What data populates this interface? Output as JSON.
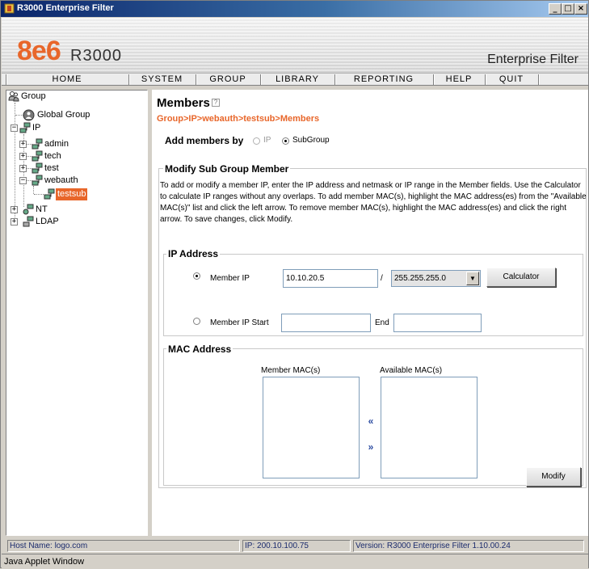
{
  "window": {
    "title": "R3000 Enterprise Filter",
    "controls": {
      "minimize": "_",
      "maximize": "□",
      "close": "×"
    }
  },
  "header": {
    "logo_brand": "8e6",
    "logo_product": "R3000",
    "tagline": "Enterprise Filter"
  },
  "nav": {
    "items": [
      "HOME",
      "SYSTEM",
      "GROUP",
      "LIBRARY",
      "REPORTING",
      "HELP",
      "QUIT"
    ]
  },
  "tree": {
    "root": "Group",
    "global_group": "Global Group",
    "ip": "IP",
    "admin": "admin",
    "tech": "tech",
    "test": "test",
    "webauth": "webauth",
    "testsub": "testsub",
    "nt": "NT",
    "ldap": "LDAP",
    "expand_collapsed": "+",
    "expand_open": "−"
  },
  "main": {
    "title": "Members",
    "help_icon": "?",
    "breadcrumb": "Group>IP>webauth>testsub>Members",
    "add_members_by": {
      "label": "Add members by",
      "options": [
        "IP",
        "SubGroup"
      ],
      "selected": "SubGroup"
    },
    "modify_frame": {
      "title": "Modify Sub Group Member",
      "description": "To add or modify a member IP, enter the IP address and netmask or IP range in the Member fields. Use the Calculator to calculate IP ranges without any overlaps. To add member MAC(s), highlight the MAC address(es) from the \"Available MAC(s)\" list and click the left arrow. To remove member MAC(s), highlight the MAC address(es) and click the right arrow. To save changes, click Modify."
    },
    "ip_address": {
      "title": "IP Address",
      "member_ip_label": "Member IP",
      "member_ip_value": "10.10.20.5",
      "slash": "/",
      "netmask_value": "255.255.255.0",
      "calculator_label": "Calculator",
      "member_ip_start_label": "Member IP Start",
      "member_ip_start_value": "",
      "end_label": "End",
      "end_value": "",
      "selected_mode": "Member IP"
    },
    "mac_address": {
      "title": "MAC Address",
      "member_macs_label": "Member MAC(s)",
      "available_macs_label": "Available MAC(s)",
      "left_arrow": "«",
      "right_arrow": "»"
    },
    "modify_label": "Modify"
  },
  "status": {
    "host": "Host Name: logo.com",
    "ip": "IP: 200.10.100.75",
    "version": "Version: R3000 Enterprise Filter 1.10.00.24"
  },
  "java_bar": "Java Applet Window",
  "colors": {
    "accent": "#e8662a",
    "titlebar": "#0a246a",
    "status_text": "#1a2a6c"
  }
}
